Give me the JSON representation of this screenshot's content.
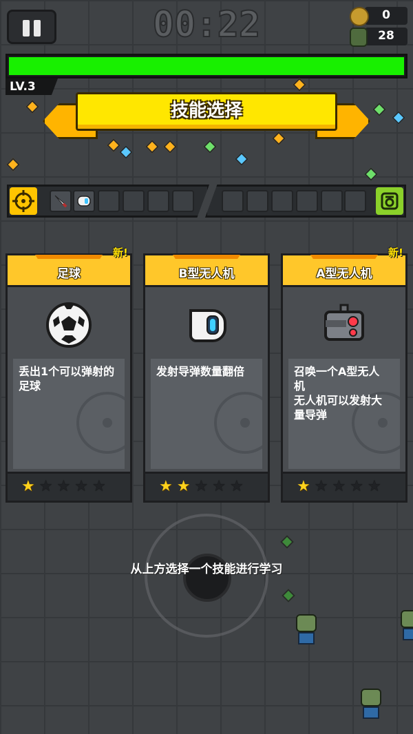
{
  "hud": {
    "timer": "00:22",
    "coins": "0",
    "kills": "28",
    "level": "LV.3",
    "xp_progress": 1.0
  },
  "banner": {
    "title": "技能选择"
  },
  "slots": {
    "weapon_slots_filled": [
      "dagger-icon",
      "drone-b-icon"
    ],
    "weapon_slot_count": 6,
    "passive_slot_count": 6
  },
  "cards": [
    {
      "title": "足球",
      "new_label": "新!",
      "show_new": true,
      "icon": "soccer-ball-icon",
      "description": "丢出1个可以弹射的\n足球",
      "stars_filled": 1,
      "stars_total": 5
    },
    {
      "title": "B型无人机",
      "new_label": "",
      "show_new": false,
      "icon": "drone-b-icon",
      "description": "发射导弹数量翻倍",
      "stars_filled": 2,
      "stars_total": 5
    },
    {
      "title": "A型无人机",
      "new_label": "新!",
      "show_new": true,
      "icon": "drone-a-icon",
      "description": "召唤一个A型无人\n机\n无人机可以发射大\n量导弹",
      "stars_filled": 1,
      "stars_total": 5
    }
  ],
  "hint": "从上方选择一个技能进行学习",
  "colors": {
    "xp_fill": "#18f000",
    "banner_yellow": "#ffe700",
    "card_header": "#ffc72a",
    "star_on": "#ffd21c"
  }
}
